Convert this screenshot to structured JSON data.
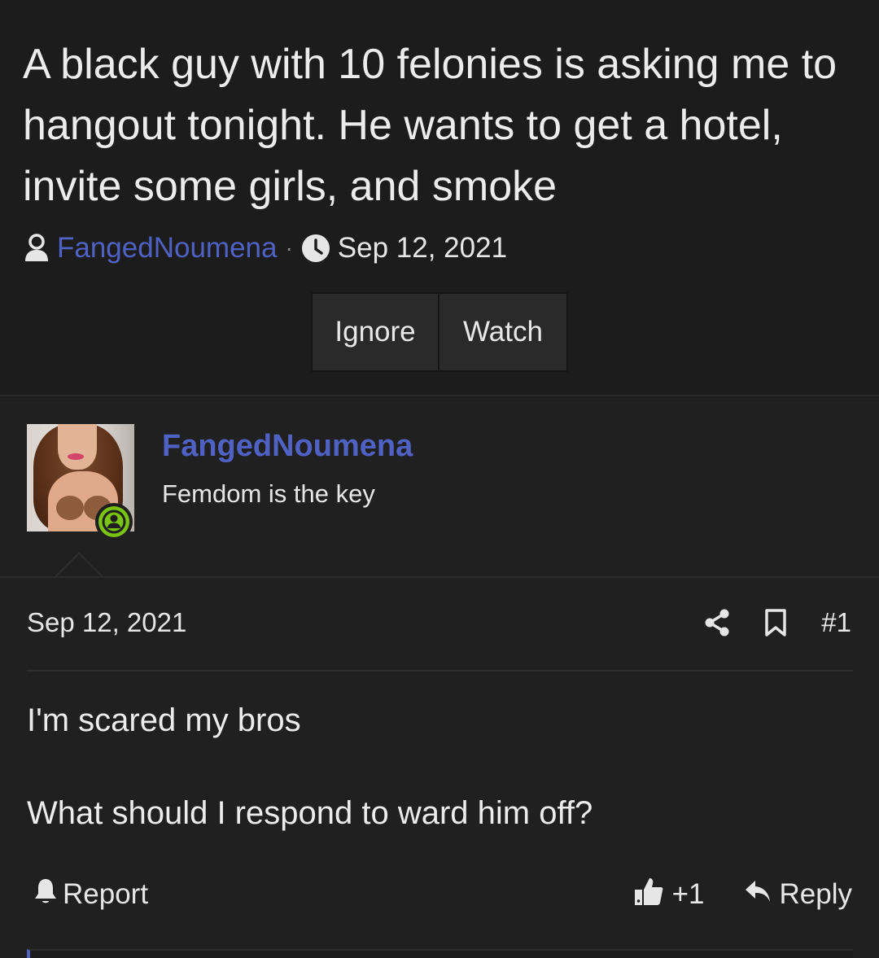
{
  "thread": {
    "title": "A black guy with 10 felonies is asking me to hangout tonight. He wants to get a hotel, invite some girls, and smoke",
    "author": "FangedNoumena",
    "separator": "·",
    "date": "Sep 12, 2021",
    "buttons": {
      "ignore": "Ignore",
      "watch": "Watch"
    }
  },
  "post": {
    "username": "FangedNoumena",
    "user_title": "Femdom is the key",
    "date": "Sep 12, 2021",
    "number": "#1",
    "message_lines": [
      "I'm scared my bros",
      "What should I respond to ward him off?"
    ],
    "report_label": "Report",
    "reaction_count": "+1",
    "reply_label": "Reply",
    "icons": [
      "user-icon",
      "clock-icon",
      "share-icon",
      "bookmark-icon",
      "bell-icon",
      "thumbs-up-icon",
      "reply-icon",
      "online-status-icon"
    ]
  },
  "colors": {
    "background": "#1c1c1c",
    "post_background": "#202020",
    "accent_link": "#4f62c4",
    "online_green": "#7ac40e"
  }
}
